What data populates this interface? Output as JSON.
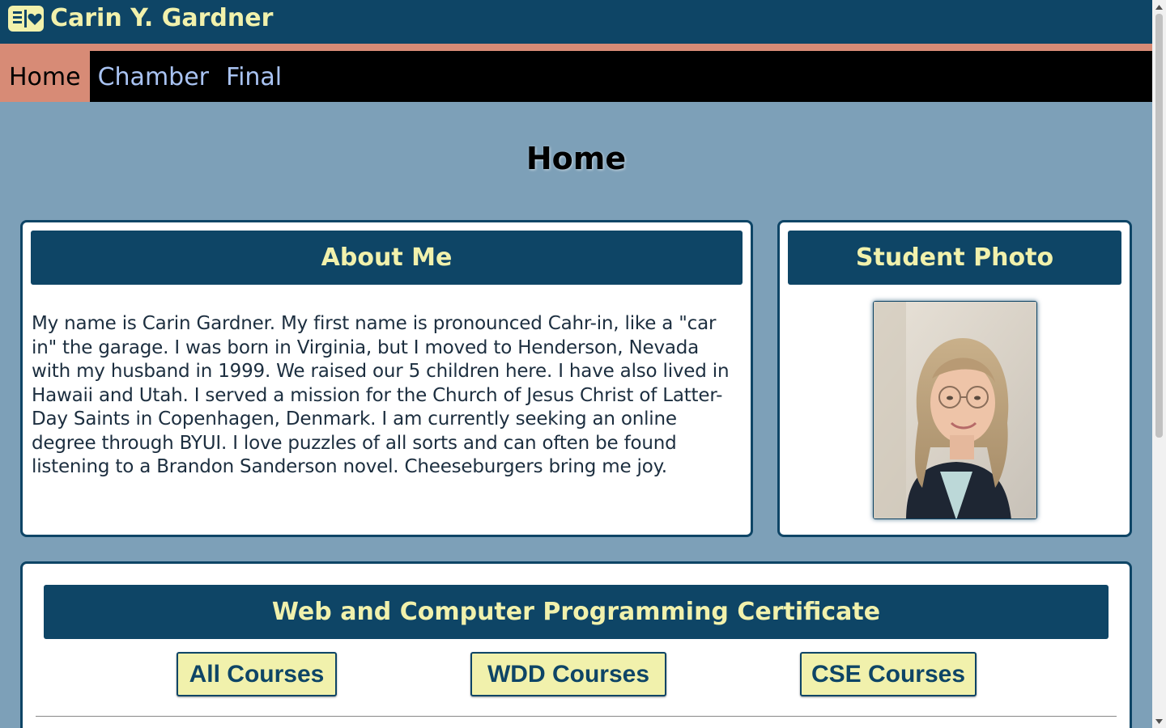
{
  "header": {
    "title": "Carin Y. Gardner",
    "logo_icon": "book-heart-icon"
  },
  "nav": {
    "items": [
      "Home",
      "Chamber",
      "Final"
    ],
    "active": "Home"
  },
  "main": {
    "page_title": "Home",
    "about": {
      "heading": "About Me",
      "text": "My name is Carin Gardner. My first name is pronounced Cahr-in, like a \"car in\" the garage. I was born in Virginia, but I moved to Henderson, Nevada with my husband in 1999. We raised our 5 children here. I have also lived in Hawaii and Utah. I served a mission for the Church of Jesus Christ of Latter-Day Saints in Copenhagen, Denmark. I am currently seeking an online degree through BYUI. I love puzzles of all sorts and can often be found listening to a Brandon Sanderson novel. Cheeseburgers bring me joy."
    },
    "photo": {
      "heading": "Student Photo"
    },
    "certificate": {
      "heading": "Web and Computer Programming Certificate",
      "buttons": [
        "All Courses",
        "WDD Courses",
        "CSE Courses"
      ]
    }
  },
  "colors": {
    "navy": "#0e4566",
    "cream": "#f1f1ac",
    "salmon": "#d78b76",
    "background": "#7da0b8",
    "nav_link": "#a9c3f2"
  }
}
